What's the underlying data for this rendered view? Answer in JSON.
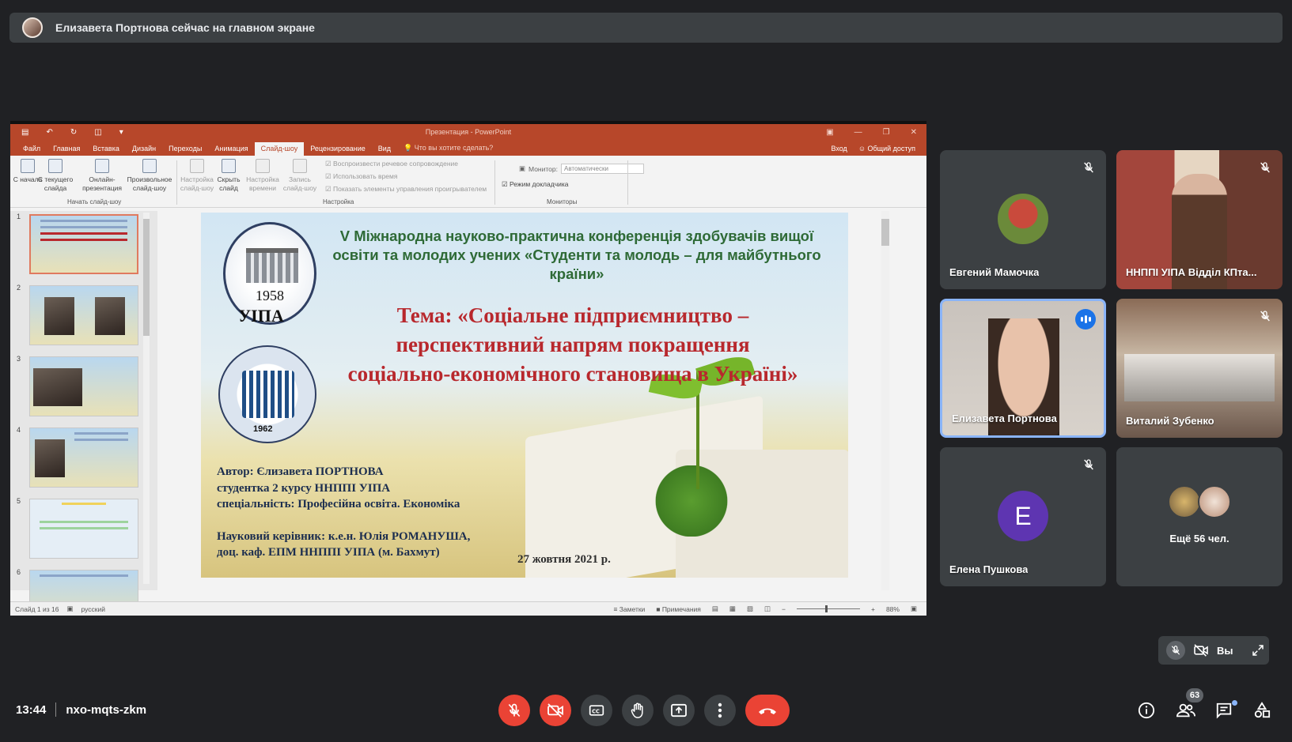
{
  "banner": {
    "text": "Елизавета Портнова сейчас на главном экране"
  },
  "powerpoint": {
    "doc_title": "Презентация - PowerPoint",
    "tabs": [
      "Файл",
      "Главная",
      "Вставка",
      "Дизайн",
      "Переходы",
      "Анимация",
      "Слайд-шоу",
      "Рецензирование",
      "Вид",
      "Что вы хотите сделать?"
    ],
    "active_tab": "Слайд-шоу",
    "account": {
      "signin": "Вход",
      "share": "Общий доступ"
    },
    "ribbon": {
      "buttons": [
        "С начала",
        "С текущего слайда",
        "Онлайн-презентация",
        "Произвольное слайд-шоу",
        "Настройка слайд-шоу",
        "Скрыть слайд",
        "Настройка времени",
        "Запись слайд-шоу"
      ],
      "group_start": "Начать слайд-шоу",
      "checks": [
        "Воспроизвести речевое сопровождение",
        "Использовать время",
        "Показать элементы управления проигрывателем"
      ],
      "group_setup": "Настройка",
      "monitor_label": "Монитор:",
      "monitor_value": "Автоматически",
      "presenter_mode": "Режим докладчика",
      "group_monitors": "Мониторы"
    },
    "slide_numbers": [
      "1",
      "2",
      "3",
      "4",
      "5",
      "6"
    ],
    "slide": {
      "logo_year_1": "1958",
      "logo_name_1": "УІПА",
      "logo_year_2": "1962",
      "heading": "V Міжнародна науково-практична конференція здобувачів вищої освіти та молодих учених «Студенти та молодь – для майбутнього країни»",
      "theme": "Тема: «Соціальне підприємництво – перспективний напрям покращення соціально-економічного становища в Україні»",
      "author_lines": [
        "Автор: Єлизавета ПОРТНОВА",
        "студентка 2 курсу ННППІ УІПА",
        "спеціальність: Професійна освіта. Економіка",
        "",
        "Науковий керівник: к.е.н. Юлія РОМАНУША,",
        "доц. каф. ЕПМ ННППІ УІПА (м. Бахмут)"
      ],
      "date": "27 жовтня 2021 р."
    },
    "status": {
      "slide_counter": "Слайд 1 из 16",
      "language": "русский",
      "notes": "Заметки",
      "comments": "Примечания",
      "zoom": "88%"
    }
  },
  "participants": [
    {
      "name": "Евгений Мамочка",
      "muted": true,
      "kind": "avatar-photo"
    },
    {
      "name": "ННППІ УІПА Відділ КПта...",
      "muted": true,
      "kind": "video"
    },
    {
      "name": "Елизавета Портнова",
      "muted": false,
      "speaking": true,
      "kind": "video"
    },
    {
      "name": "Виталий Зубенко",
      "muted": true,
      "kind": "video"
    },
    {
      "name": "Елена Пушкова",
      "muted": true,
      "kind": "letter",
      "letter": "E",
      "color": "#5e35b1"
    }
  ],
  "more_tile": {
    "text": "Ещё 56 чел."
  },
  "self_view": {
    "label": "Вы"
  },
  "meeting": {
    "time": "13:44",
    "code": "nxo-mqts-zkm"
  },
  "controls": {
    "mic": "mic-off-icon",
    "camera": "camera-off-icon",
    "captions": "captions-icon",
    "hand": "raise-hand-icon",
    "present": "present-screen-icon",
    "more": "more-vert-icon",
    "end": "end-call-icon"
  },
  "right_controls": {
    "people_count": "63"
  },
  "colors": {
    "red": "#ea4335",
    "grey": "#3c4043",
    "accent": "#8ab4f8",
    "ppt_brand": "#b7472a"
  }
}
